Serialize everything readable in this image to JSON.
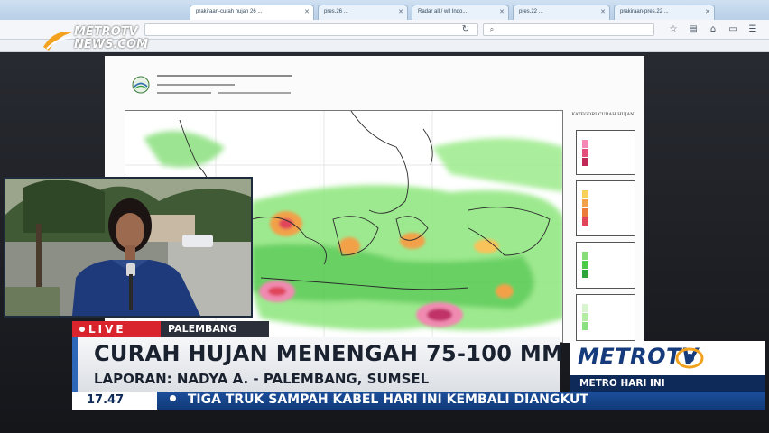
{
  "browser": {
    "tabs": [
      {
        "label": "prakiraan-curah hujan 26 ...",
        "active": true
      },
      {
        "label": "pres.26 ...",
        "active": false
      },
      {
        "label": "Radar all / wil Indo...",
        "active": false
      },
      {
        "label": "pres.22 ...",
        "active": false
      },
      {
        "label": "prakiraan-pres.22 ...",
        "active": false
      }
    ]
  },
  "forecast_doc": {
    "legend_title": "KATEGORI CURAH HUJAN"
  },
  "broadcast": {
    "live_label": "LIVE",
    "location": "PALEMBANG",
    "headline": "CURAH HUJAN MENENGAH 75-100 MM",
    "subline": "LAPORAN: NADYA A. - PALEMBANG, SUMSEL",
    "brand": "METROTV",
    "program": "METRO HARI INI",
    "clock": "17.47",
    "ticker": "TIGA TRUK SAMPAH KABEL HARI INI KEMBALI DIANGKUT",
    "watermark_top": "METROTV",
    "watermark_bottom": "NEWS.COM"
  },
  "colors": {
    "live_red": "#d9232d",
    "brand_navy": "#0e2a59",
    "ticker_blue": "#1d4f9b",
    "rain_green": "#5fd65a",
    "rain_red": "#e0455a"
  }
}
